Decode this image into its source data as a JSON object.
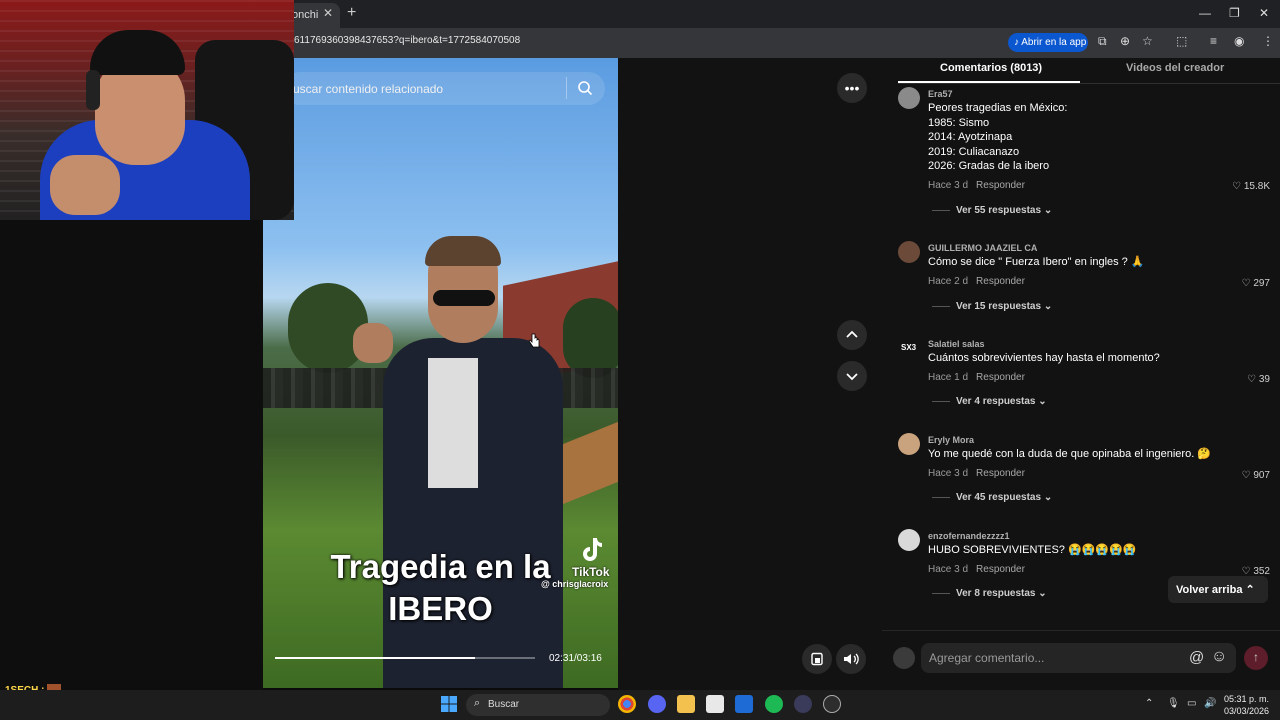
{
  "browser": {
    "tab_title": "onchi",
    "url": "611769360398437653?q=ibero&t=1772584070508",
    "open_in_app": "Abrir en la app"
  },
  "video": {
    "search_placeholder": "uscar contenido relacionado",
    "caption_line1": "Tragedia en la",
    "caption_line2": "IBERO",
    "brand": "TikTok",
    "handle": "@ chrisglacroix",
    "time": "02:31/03:16",
    "progress": 0.77
  },
  "comments_panel": {
    "tab_comments": "Comentarios (8013)",
    "tab_creator": "Videos del creador",
    "items": [
      {
        "user": "Era57",
        "text": "Peores tragedias en México:\n1985: Sismo\n2014: Ayotzinapa\n2019: Culiacanazo\n2026: Gradas de la ibero",
        "time": "Hace 3 d",
        "reply": "Responder",
        "likes": "15.8K",
        "more": "Ver 55 respuestas"
      },
      {
        "user": "GUILLERMO JAAZIEL CA",
        "text": "Cómo se dice \" Fuerza Ibero\" en ingles ? 🙏",
        "time": "Hace 2 d",
        "reply": "Responder",
        "likes": "297",
        "more": "Ver 15 respuestas"
      },
      {
        "user": "Salatiel salas",
        "text": "Cuántos sobrevivientes hay hasta el momento?",
        "time": "Hace 1 d",
        "reply": "Responder",
        "likes": "39",
        "more": "Ver 4 respuestas",
        "avatar_text": "SX3"
      },
      {
        "user": "Eryly Mora",
        "text": "Yo me quedé con la duda de que opinaba el ingeniero. 🤔",
        "time": "Hace 3 d",
        "reply": "Responder",
        "likes": "907",
        "more": "Ver 45 respuestas"
      },
      {
        "user": "enzofernandezzzz1",
        "text": "HUBO SOBREVIVIENTES? 😭😭😭😭😭",
        "time": "Hace 3 d",
        "reply": "Responder",
        "likes": "352",
        "more": "Ver 8 respuestas"
      }
    ],
    "back_to_top": "Volver arriba",
    "add_comment_placeholder": "Agregar comentario..."
  },
  "stream_chat": {
    "user": "1SECH :"
  },
  "taskbar": {
    "search": "Buscar",
    "time": "05:31 p. m.",
    "date": "03/03/2026"
  },
  "colors": {
    "accent_blue": "#0b57d0",
    "send_red": "#5d1d2a",
    "chat_yellow": "#ffd84a"
  }
}
